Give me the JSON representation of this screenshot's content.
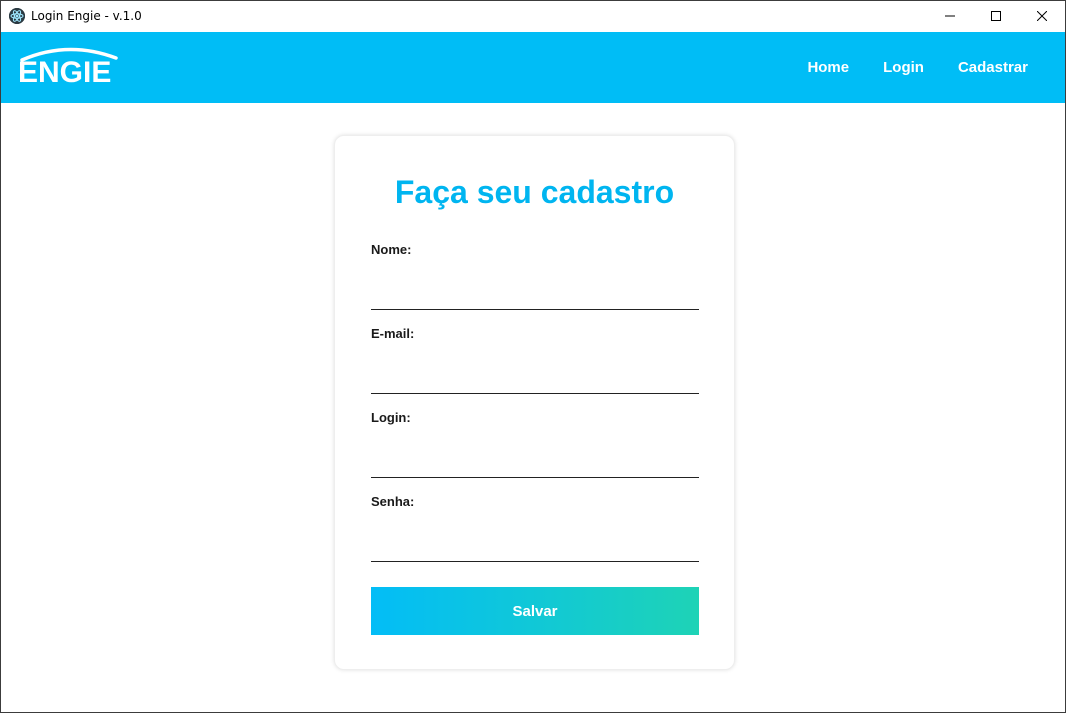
{
  "window": {
    "title": "Login Engie - v.1.0",
    "icon": "app-icon",
    "controls": [
      "minimize-icon",
      "maximize-icon",
      "close-icon"
    ]
  },
  "navbar": {
    "logo_text": "ENGIE",
    "background": "#00bdf6",
    "links": [
      {
        "label": "Home"
      },
      {
        "label": "Login"
      },
      {
        "label": "Cadastrar"
      }
    ]
  },
  "form": {
    "title": "Faça seu cadastro",
    "title_color": "#00b5f0",
    "fields": [
      {
        "label": "Nome:",
        "value": ""
      },
      {
        "label": "E-mail:",
        "value": ""
      },
      {
        "label": "Login:",
        "value": ""
      },
      {
        "label": "Senha:",
        "value": ""
      }
    ],
    "submit_label": "Salvar",
    "submit_gradient": [
      "#03bdf7",
      "#1ed3b6"
    ]
  }
}
